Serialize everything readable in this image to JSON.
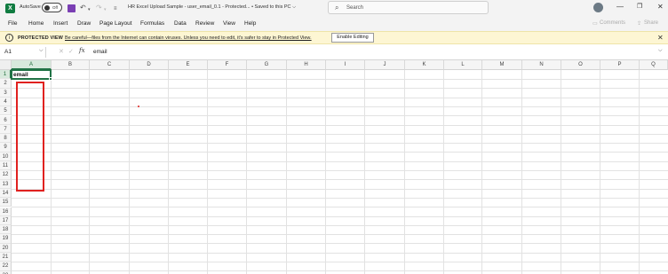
{
  "titlebar": {
    "autosave_label": "AutoSave",
    "autosave_state": "Off",
    "doc_title": "HR Excel Upload Sample - user_email_0.1  -  Protected...  •  Saved to this PC ⌵",
    "search_placeholder": "Search",
    "icons": [
      "excel-logo-icon",
      "save-icon",
      "undo-icon",
      "redo-icon",
      "customize-icon",
      "search-icon",
      "avatar",
      "minimize-icon",
      "restore-icon",
      "close-icon"
    ]
  },
  "menu": {
    "items": [
      "File",
      "Home",
      "Insert",
      "Draw",
      "Page Layout",
      "Formulas",
      "Data",
      "Review",
      "View",
      "Help"
    ],
    "comments": "Comments",
    "share": "Share"
  },
  "protected_view": {
    "title": "PROTECTED VIEW",
    "message": "Be careful—files from the Internet can contain viruses. Unless you need to edit, it's safer to stay in Protected View.",
    "button": "Enable Editing"
  },
  "formula_bar": {
    "name_box": "A1",
    "value": "email"
  },
  "sheet": {
    "columns": [
      "A",
      "B",
      "C",
      "D",
      "E",
      "F",
      "G",
      "H",
      "I",
      "J",
      "K",
      "L",
      "M",
      "N",
      "O",
      "P",
      "Q"
    ],
    "rows": [
      "1",
      "2",
      "3",
      "4",
      "5",
      "6",
      "7",
      "8",
      "9",
      "10",
      "11",
      "12",
      "13",
      "14",
      "15",
      "16",
      "17",
      "18",
      "19",
      "20",
      "21",
      "22",
      "23"
    ],
    "selected_column": "A",
    "selected_row": "1",
    "a1": "email"
  },
  "colors": {
    "excel_green": "#217346",
    "annotation_red": "#e0211f",
    "protected_bar": "#fdf6d3"
  }
}
